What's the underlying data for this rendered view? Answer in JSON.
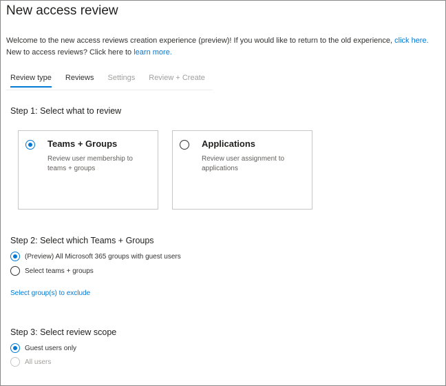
{
  "page": {
    "title": "New access review",
    "intro_line1": "Welcome to the new access reviews creation experience (preview)! If you would like to return to the old experience, ",
    "intro_link1": "click here.",
    "intro_line2": "New to access reviews? Click here to ",
    "intro_link2": "learn more."
  },
  "tabs": [
    {
      "label": "Review type",
      "state": "active"
    },
    {
      "label": "Reviews",
      "state": "enabled"
    },
    {
      "label": "Settings",
      "state": "disabled"
    },
    {
      "label": "Review + Create",
      "state": "disabled"
    }
  ],
  "step1": {
    "heading": "Step 1: Select what to review",
    "cards": [
      {
        "title": "Teams + Groups",
        "description": "Review user membership to teams + groups",
        "selected": true
      },
      {
        "title": "Applications",
        "description": "Review user assignment to applications",
        "selected": false
      }
    ]
  },
  "step2": {
    "heading": "Step 2: Select which Teams + Groups",
    "options": [
      {
        "label": "(Preview) All Microsoft 365 groups with guest users",
        "selected": true
      },
      {
        "label": "Select teams + groups",
        "selected": false
      }
    ],
    "exclude_link": "Select group(s) to exclude"
  },
  "step3": {
    "heading": "Step 3: Select review scope",
    "options": [
      {
        "label": "Guest users only",
        "selected": true,
        "disabled": false
      },
      {
        "label": "All users",
        "selected": false,
        "disabled": true
      }
    ]
  },
  "colors": {
    "accent": "#0078d4",
    "text": "#323130",
    "disabled": "#a19f9d",
    "border": "#c8c6c4"
  },
  "icons": {
    "radio_selected": "radio-selected-icon",
    "radio_unselected": "radio-unselected-icon"
  }
}
